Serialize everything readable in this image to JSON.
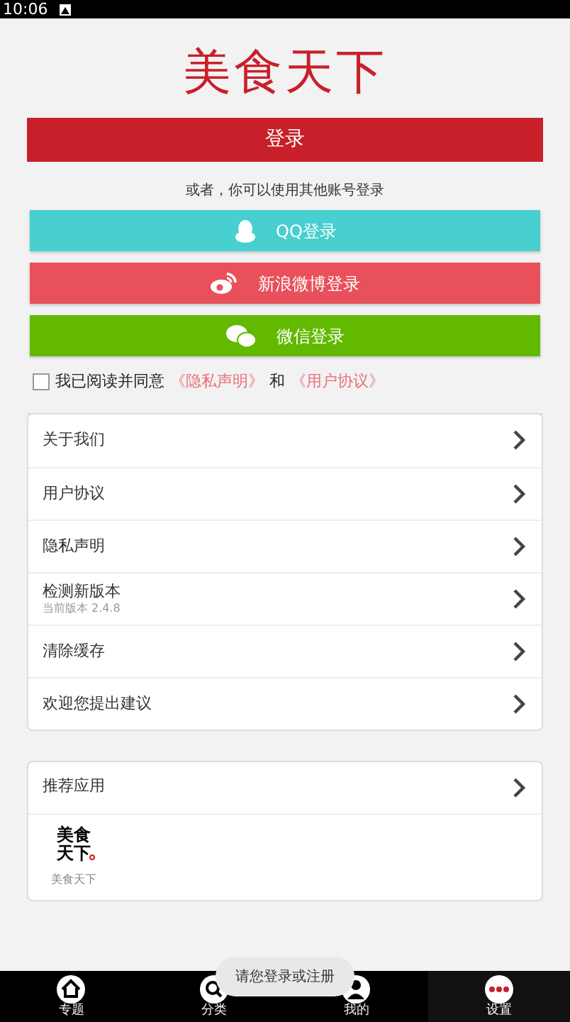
{
  "status_bar": {
    "time": "10:06"
  },
  "app_title": "美食天下",
  "login_button": "登录",
  "alt_login_hint": "或者，你可以使用其他账号登录",
  "social_logins": [
    {
      "kind": "qq",
      "label": "QQ登录",
      "color": "#48cfcf"
    },
    {
      "kind": "weibo",
      "label": "新浪微博登录",
      "color": "#e8505b"
    },
    {
      "kind": "wechat",
      "label": "微信登录",
      "color": "#62b900"
    }
  ],
  "agreement": {
    "checked": false,
    "prefix": "我已阅读并同意",
    "privacy_link": "《隐私声明》",
    "joiner": "和",
    "terms_link": "《用户协议》"
  },
  "settings": [
    {
      "label": "关于我们"
    },
    {
      "label": "用户协议"
    },
    {
      "label": "隐私声明"
    },
    {
      "label": "检测新版本",
      "sublabel": "当前版本 2.4.8"
    },
    {
      "label": "清除缓存"
    },
    {
      "label": "欢迎您提出建议"
    }
  ],
  "recommended": {
    "title": "推荐应用",
    "apps": [
      {
        "logo_lines": [
          "美食",
          "天下"
        ],
        "name": "美食天下"
      }
    ]
  },
  "toast": "请您登录或注册",
  "tabs": [
    {
      "kind": "home",
      "label": "专题",
      "selected": false
    },
    {
      "kind": "search",
      "label": "分类",
      "selected": false
    },
    {
      "kind": "user",
      "label": "我的",
      "selected": false
    },
    {
      "kind": "more",
      "label": "设置",
      "selected": true
    }
  ]
}
